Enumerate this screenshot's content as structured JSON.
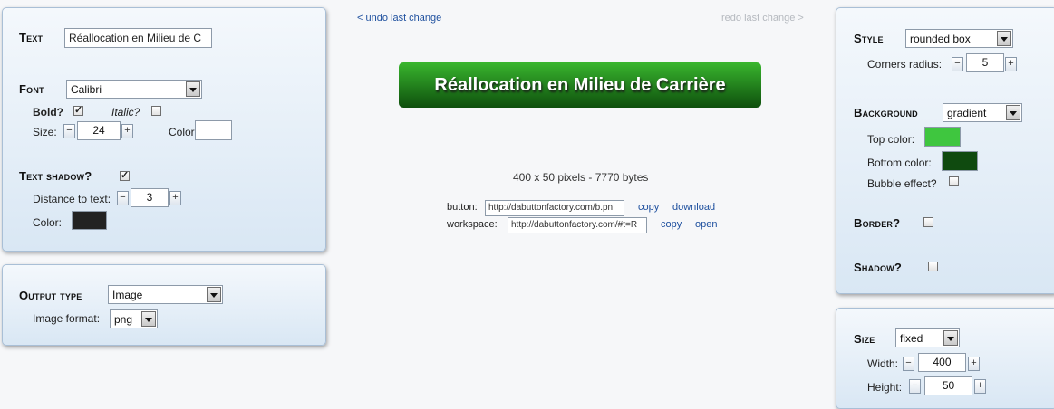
{
  "text_panel": {
    "text_label": "Text",
    "text_value": "Réallocation en Milieu de C",
    "font_label": "Font",
    "font_value": "Calibri",
    "bold_label": "Bold?",
    "bold_checked": true,
    "italic_label": "Italic?",
    "italic_checked": false,
    "size_label": "Size:",
    "size_value": "24",
    "color_label": "Color:",
    "color_value": "#ffffff",
    "shadow_label": "Text shadow?",
    "shadow_checked": true,
    "distance_label": "Distance to text:",
    "distance_value": "3",
    "shadow_color_label": "Color:",
    "shadow_color_value": "#222222"
  },
  "output_panel": {
    "output_label": "Output type",
    "output_value": "Image",
    "format_label": "Image format:",
    "format_value": "png"
  },
  "center": {
    "undo": "< undo last change",
    "redo": "redo last change >",
    "button_text": "Réallocation en Milieu de Carrière",
    "info": "400 x 50 pixels - 7770 bytes",
    "button_label": "button:",
    "button_url": "http://dabuttonfactory.com/b.pn",
    "copy1": "copy",
    "download": "download",
    "workspace_label": "workspace:",
    "workspace_url": "http://dabuttonfactory.com/#t=R",
    "copy2": "copy",
    "open": "open"
  },
  "style_panel": {
    "style_label": "Style",
    "style_value": "rounded box",
    "radius_label": "Corners radius:",
    "radius_value": "5",
    "background_label": "Background",
    "background_value": "gradient",
    "top_color_label": "Top color:",
    "top_color_value": "#3fc63f",
    "bottom_color_label": "Bottom color:",
    "bottom_color_value": "#0f4a0f",
    "bubble_label": "Bubble effect?",
    "bubble_checked": false,
    "border_label": "Border?",
    "border_checked": false,
    "shadow_label": "Shadow?",
    "shadow_checked": false
  },
  "size_panel": {
    "size_label": "Size",
    "size_value": "fixed",
    "width_label": "Width:",
    "width_value": "400",
    "height_label": "Height:",
    "height_value": "50"
  }
}
